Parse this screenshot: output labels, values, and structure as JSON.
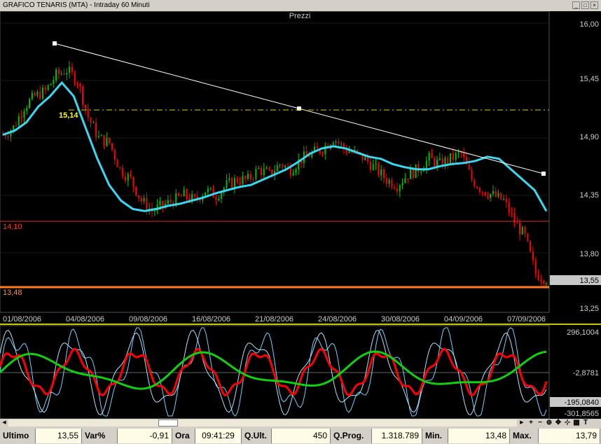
{
  "window": {
    "title": "GRAFICO TENARIS (MTA) - Intraday 60 Minuti"
  },
  "price_panel": {
    "title": "Prezzi",
    "y_ticks": [
      "16,00",
      "15,45",
      "14,90",
      "14,35",
      "13,80",
      "13,25"
    ],
    "last_price_label": "13,55",
    "annotation_high": "15,14",
    "support_upper_label": "14,10",
    "support_lower_label": "13,48",
    "x_ticks": [
      "01/08/2006",
      "04/08/2006",
      "09/08/2006",
      "16/08/2006",
      "21/08/2006",
      "24/08/2006",
      "30/08/2006",
      "04/09/2006",
      "07/09/2006"
    ]
  },
  "oscillator_panel": {
    "y_ticks": [
      "296,1004",
      "-2,8781",
      "-195,0840",
      "-301,8565"
    ]
  },
  "status": {
    "ultimo_label": "Ultimo",
    "ultimo_value": "13,55",
    "var_label": "Var%",
    "var_value": "-0,91",
    "ora_label": "Ora",
    "ora_value": "09:41:29",
    "qult_label": "Q.Ult.",
    "qult_value": "450",
    "qprog_label": "Q.Prog.",
    "qprog_value": "1.318.789",
    "min_label": "Min.",
    "min_value": "13,48",
    "max_label": "Max.",
    "max_value": "13,79"
  },
  "colors": {
    "ma_line": "#3ad7f0",
    "bull": "#00c000",
    "bear": "#ff0000",
    "support": "#ff4020",
    "osc_fast": "#6fd3ff",
    "osc_slow": "#10d010",
    "osc_red": "#ff0000"
  },
  "chart_data": [
    {
      "type": "line",
      "title": "Prezzi",
      "ylim": [
        13.25,
        16.0
      ],
      "series": [
        {
          "values": [
            14.93,
            15.0,
            15.2,
            15.3,
            15.35,
            15.5,
            15.55,
            15.45,
            15.1,
            14.9,
            14.85,
            14.6,
            14.5,
            14.3,
            14.2,
            14.25,
            14.3,
            14.35,
            14.3,
            14.4,
            14.35,
            14.45,
            14.5,
            14.5,
            14.6,
            14.55,
            14.65,
            14.6,
            14.7,
            14.75,
            14.8,
            14.9,
            14.8,
            14.75,
            14.7,
            14.6,
            14.5,
            14.45,
            14.55,
            14.6,
            14.7,
            14.65,
            14.7,
            14.75,
            14.5,
            14.4,
            14.35,
            14.3,
            14.1,
            13.95,
            13.6,
            13.55
          ]
        },
        {
          "values": [
            14.93,
            14.97,
            15.05,
            15.2,
            15.3,
            15.43,
            15.3,
            15.0,
            14.7,
            14.45,
            14.3,
            14.22,
            14.2,
            14.22,
            14.25,
            14.27,
            14.3,
            14.33,
            14.37,
            14.4,
            14.43,
            14.45,
            14.5,
            14.55,
            14.6,
            14.67,
            14.75,
            14.8,
            14.82,
            14.8,
            14.76,
            14.72,
            14.7,
            14.65,
            14.62,
            14.6,
            14.6,
            14.63,
            14.65,
            14.66,
            14.68,
            14.72,
            14.7,
            14.6,
            14.5,
            14.4,
            14.2
          ]
        }
      ]
    },
    {
      "type": "line",
      "ylim": [
        -301.8565,
        296.1004
      ]
    }
  ]
}
